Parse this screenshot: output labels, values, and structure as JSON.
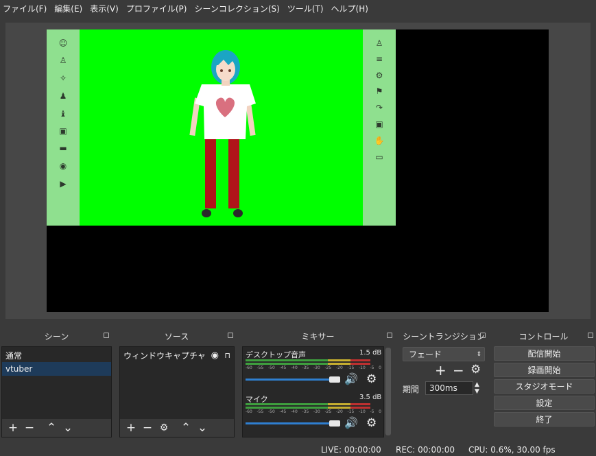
{
  "menu": [
    "ファイル(F)",
    "編集(E)",
    "表示(V)",
    "プロファイル(P)",
    "シーンコレクション(S)",
    "ツール(T)",
    "ヘルプ(H)"
  ],
  "docks": {
    "scenes": {
      "title": "シーン",
      "items": [
        "通常",
        "vtuber"
      ],
      "selected": "vtuber"
    },
    "sources": {
      "title": "ソース",
      "items": [
        "ウィンドウキャプチャ"
      ]
    },
    "mixer": {
      "title": "ミキサー",
      "channels": [
        {
          "name": "デスクトップ音声",
          "db": "1.5 dB",
          "level": 0.92
        },
        {
          "name": "マイク",
          "db": "3.5 dB",
          "level": 0.92
        }
      ],
      "scale": [
        "-60",
        "-55",
        "-50",
        "-45",
        "-40",
        "-35",
        "-30",
        "-25",
        "-20",
        "-15",
        "-10",
        "-5",
        "0"
      ]
    },
    "transitions": {
      "title": "シーントランジション",
      "type": "フェード",
      "duration_label": "期間",
      "duration": "300ms"
    },
    "controls": {
      "title": "コントロール",
      "buttons": [
        "配信開始",
        "録画開始",
        "スタジオモード",
        "設定",
        "終了"
      ]
    }
  },
  "status": {
    "live": "LIVE: 00:00:00",
    "rec": "REC: 00:00:00",
    "cpu": "CPU: 0.6%, 30.00 fps"
  },
  "colors": {
    "accent": "#2f7fd0",
    "chroma": "#00ff00",
    "selected": "#1e3b5a"
  }
}
